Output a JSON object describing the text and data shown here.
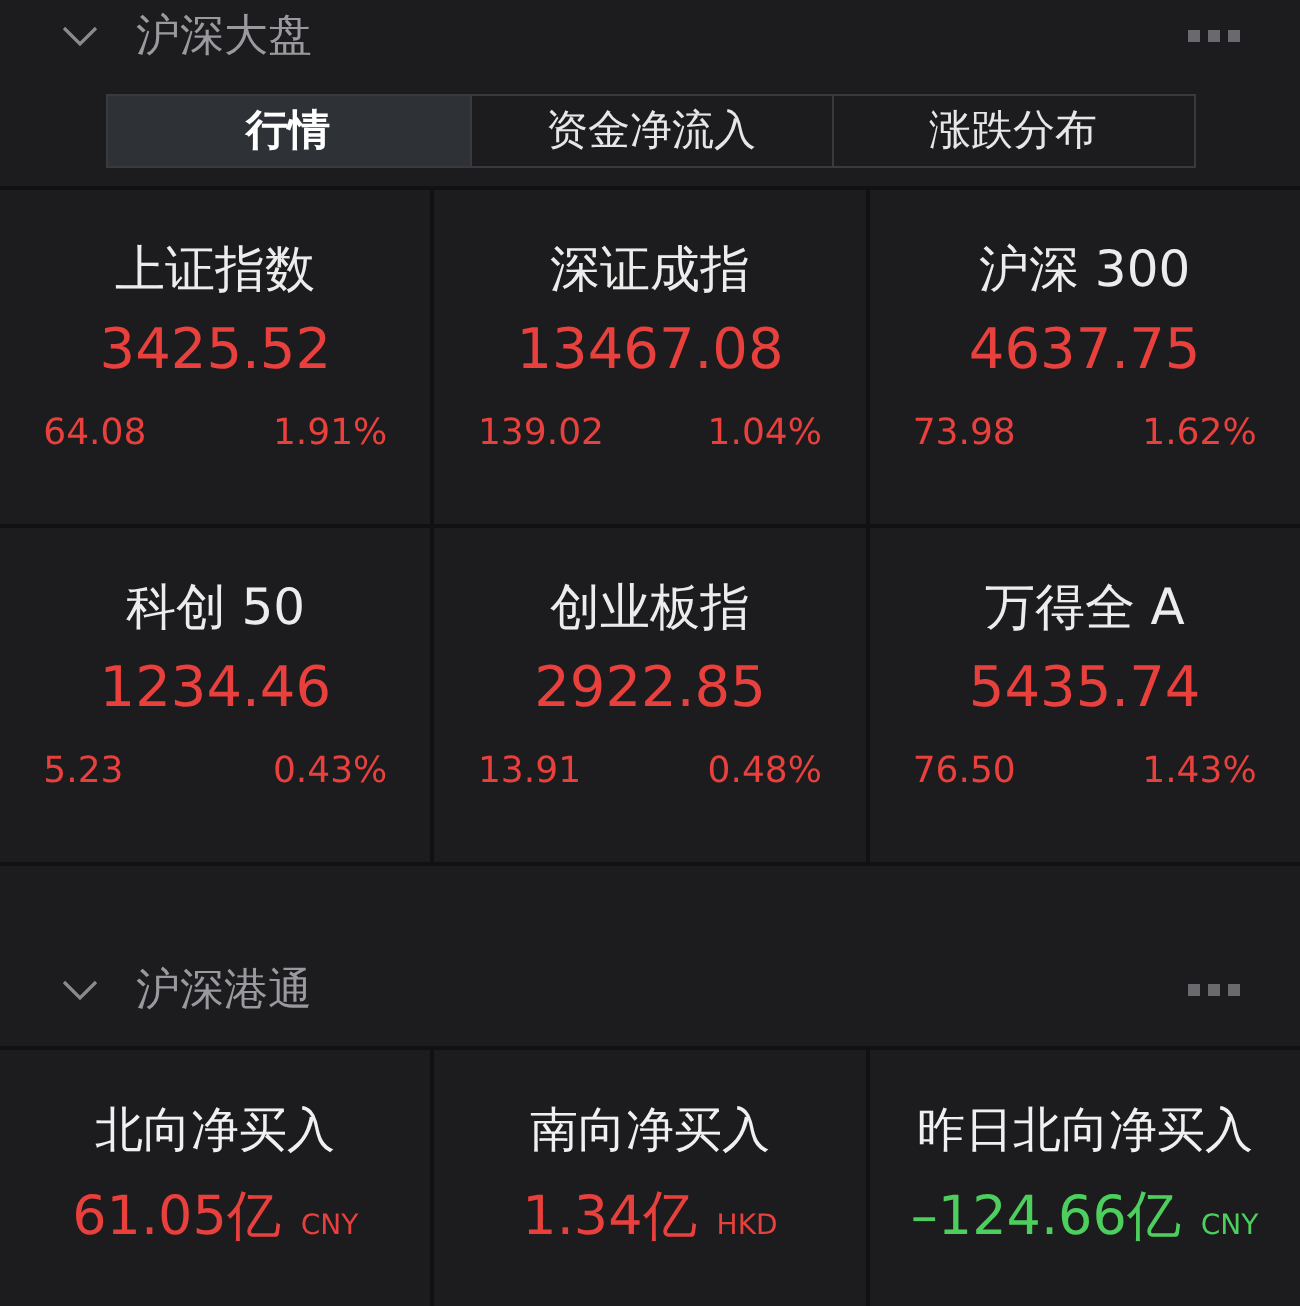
{
  "market": {
    "title": "沪深大盘",
    "expanded": true,
    "tabs": [
      {
        "label": "行情",
        "selected": true
      },
      {
        "label": "资金净流入",
        "selected": false
      },
      {
        "label": "涨跌分布",
        "selected": false
      }
    ],
    "indices": [
      {
        "name": "上证指数",
        "value": "3425.52",
        "change": "64.08",
        "percent": "1.91%",
        "color": "#e8403c"
      },
      {
        "name": "深证成指",
        "value": "13467.08",
        "change": "139.02",
        "percent": "1.04%",
        "color": "#e8403c"
      },
      {
        "name": "沪深 300",
        "value": "4637.75",
        "change": "73.98",
        "percent": "1.62%",
        "color": "#e8403c"
      },
      {
        "name": "科创 50",
        "value": "1234.46",
        "change": "5.23",
        "percent": "0.43%",
        "color": "#e8403c"
      },
      {
        "name": "创业板指",
        "value": "2922.85",
        "change": "13.91",
        "percent": "0.48%",
        "color": "#e8403c"
      },
      {
        "name": "万得全 A",
        "value": "5435.74",
        "change": "76.50",
        "percent": "1.43%",
        "color": "#e8403c"
      }
    ]
  },
  "connect": {
    "title": "沪深港通",
    "expanded": true,
    "cards": [
      {
        "name": "北向净买入",
        "value": "61.05亿",
        "currency": "CNY",
        "color": "#e8403c"
      },
      {
        "name": "南向净买入",
        "value": "1.34亿",
        "currency": "HKD",
        "color": "#e8403c"
      },
      {
        "name": "昨日北向净买入",
        "value": "–124.66亿",
        "currency": "CNY",
        "color": "#4ccf5c"
      }
    ]
  }
}
